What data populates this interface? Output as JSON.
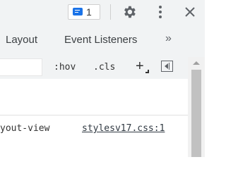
{
  "toolbar": {
    "issues_count": "1",
    "icons": [
      "issues-icon",
      "gear-icon",
      "kebab-menu-icon",
      "close-icon"
    ]
  },
  "tabs": {
    "items": [
      "Layout",
      "Event Listeners"
    ],
    "more_label": "»"
  },
  "styles_toolbar": {
    "filter_value": "",
    "hov_label": ":hov",
    "cls_label": ".cls",
    "new_rule_label": "+"
  },
  "styles_pane": {
    "rule_selector": "yout-view",
    "rule_source": "stylesv17.css:1"
  },
  "colors": {
    "accent": "#1a73e8",
    "toolbar_bg": "#f1f3f4",
    "icon": "#5f6368"
  }
}
